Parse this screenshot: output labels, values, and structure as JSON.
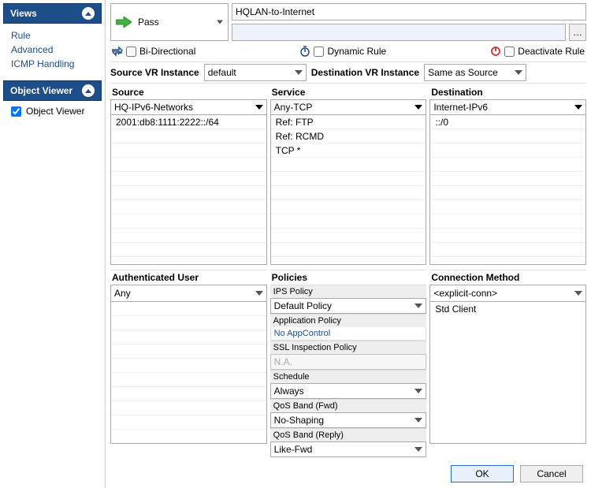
{
  "sidebar": {
    "views": {
      "title": "Views",
      "items": [
        "Rule",
        "Advanced",
        "ICMP Handling"
      ]
    },
    "objectViewer": {
      "title": "Object Viewer",
      "checkboxLabel": "Object Viewer",
      "checked": true
    }
  },
  "rule": {
    "action": "Pass",
    "name": "HQLAN-to-Internet",
    "description": "",
    "biDirectional": {
      "label": "Bi-Directional",
      "checked": false
    },
    "dynamicRule": {
      "label": "Dynamic Rule",
      "checked": false
    },
    "deactivate": {
      "label": "Deactivate Rule",
      "checked": false
    }
  },
  "vr": {
    "sourceLabel": "Source VR Instance",
    "sourceValue": "default",
    "destLabel": "Destination VR Instance",
    "destValue": "Same as Source"
  },
  "columns": {
    "source": {
      "label": "Source",
      "selected": "HQ-IPv6-Networks",
      "items": [
        "2001:db8:1111:2222::/64"
      ]
    },
    "service": {
      "label": "Service",
      "selected": "Any-TCP",
      "items": [
        "Ref: FTP",
        "Ref: RCMD",
        "TCP  *"
      ]
    },
    "destination": {
      "label": "Destination",
      "selected": "Internet-IPv6",
      "items": [
        "::/0"
      ]
    }
  },
  "lower": {
    "auth": {
      "label": "Authenticated User",
      "selected": "Any"
    },
    "policies": {
      "label": "Policies",
      "ipsPolicy": {
        "sub": "IPS Policy",
        "value": "Default Policy"
      },
      "appPolicy": {
        "sub": "Application Policy",
        "link": "No AppControl"
      },
      "sslPolicy": {
        "sub": "SSL Inspection Policy",
        "value": "N.A."
      },
      "schedule": {
        "sub": "Schedule",
        "value": "Always"
      },
      "qosFwd": {
        "sub": "QoS Band (Fwd)",
        "value": "No-Shaping"
      },
      "qosReply": {
        "sub": "QoS Band (Reply)",
        "value": "Like-Fwd"
      }
    },
    "connection": {
      "label": "Connection Method",
      "selected": "<explicit-conn>",
      "items": [
        "Std Client"
      ]
    }
  },
  "buttons": {
    "ok": "OK",
    "cancel": "Cancel"
  }
}
